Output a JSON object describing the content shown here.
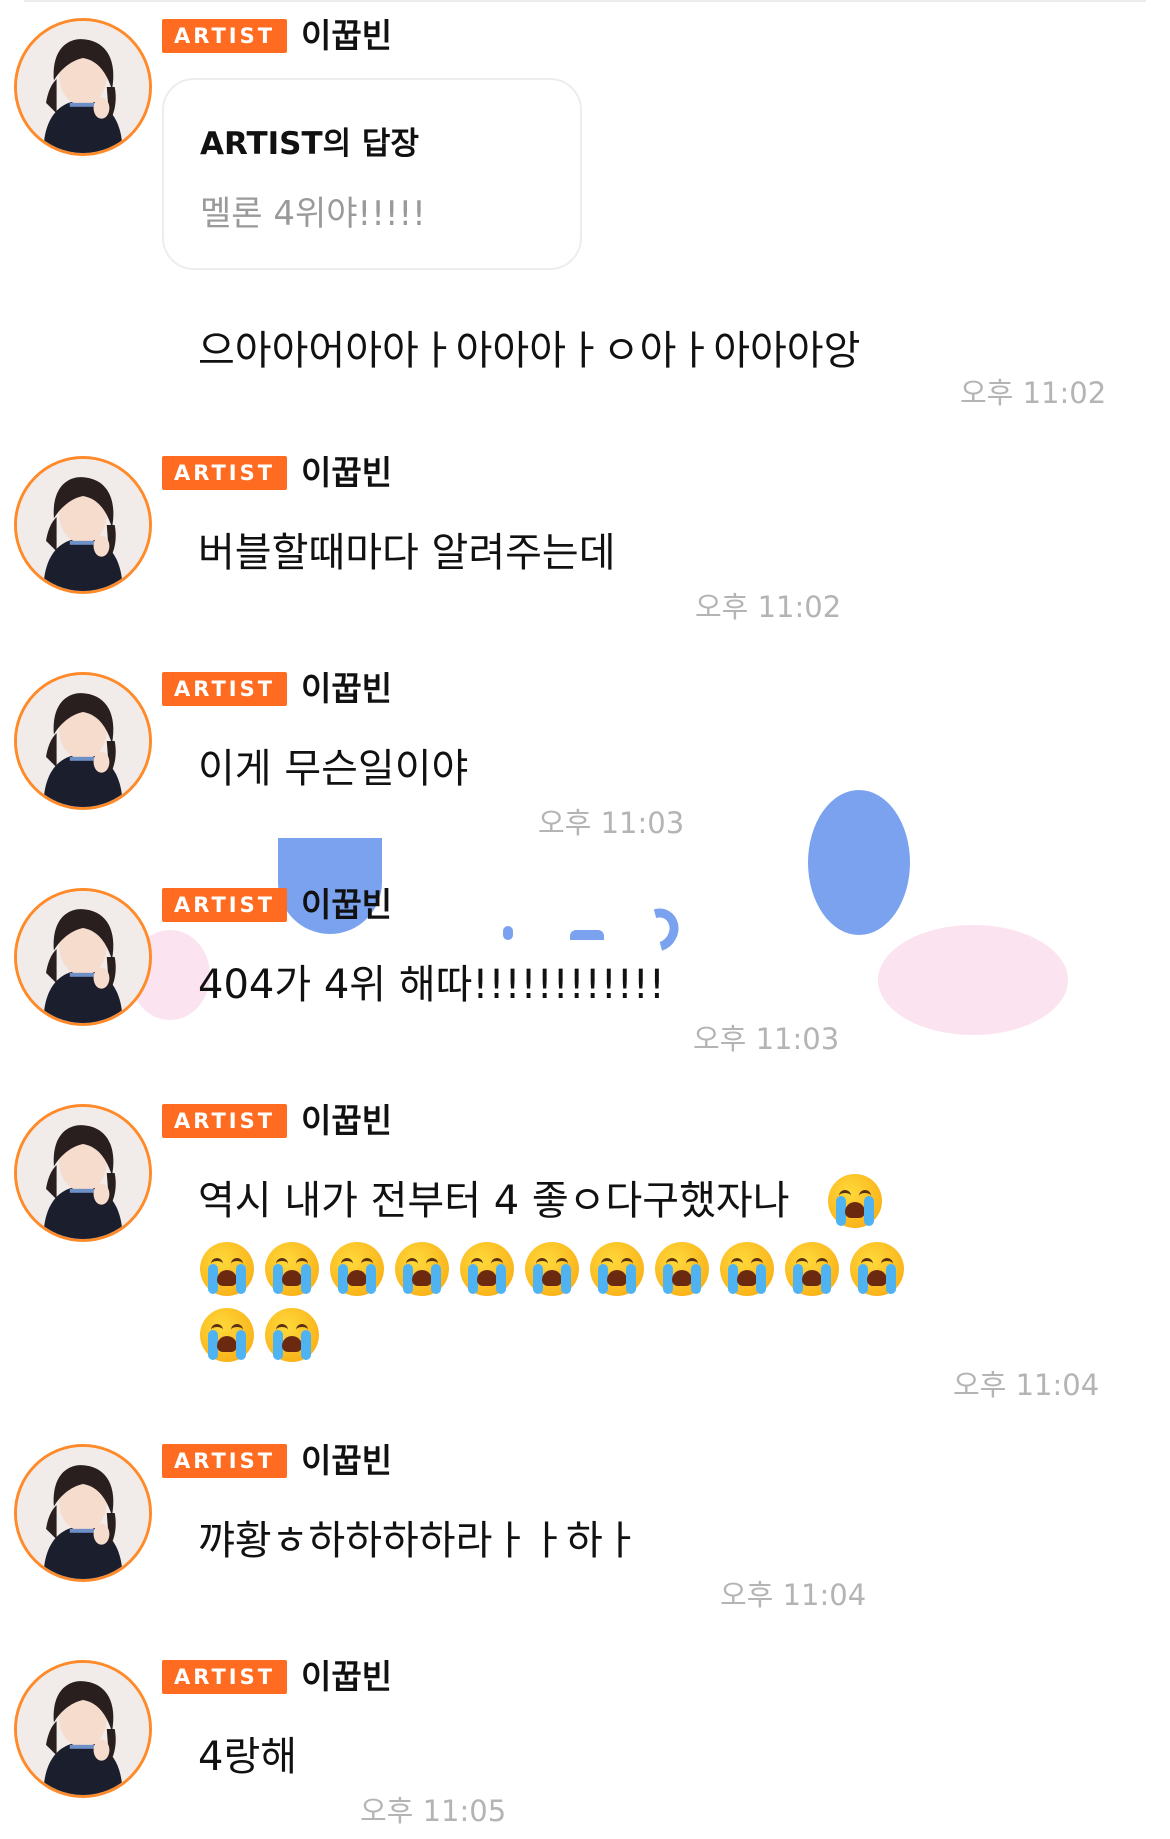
{
  "colors": {
    "badge": "#ff6b21",
    "avatar_ring": "#ff8a2a",
    "timestamp": "#b4b4b4",
    "reply_body": "#9a9a9a"
  },
  "icons": {
    "emoji": "loudly-crying-face-icon",
    "avatar": "artist-avatar"
  },
  "messages": [
    {
      "badge": "ARTIST",
      "name": "이꿉빈",
      "reply": {
        "title": "ARTIST의 답장",
        "body": "멜론 4위야!!!!!"
      },
      "text": "으아아어아아ㅏ아아아ㅏㅇ아ㅏ아아아앙",
      "time": "오후 11:02"
    },
    {
      "badge": "ARTIST",
      "name": "이꿉빈",
      "text": "버블할때마다 알려주는데",
      "time": "오후 11:02"
    },
    {
      "badge": "ARTIST",
      "name": "이꿉빈",
      "text": "이게 무슨일이야",
      "time": "오후 11:03"
    },
    {
      "badge": "ARTIST",
      "name": "이꿉빈",
      "text": "404가 4위 해따!!!!!!!!!!!!",
      "time": "오후 11:03"
    },
    {
      "badge": "ARTIST",
      "name": "이꿉빈",
      "text": "역시 내가 전부터 4 좋ㅇ다구했자나",
      "emoji_count_line1": 1,
      "emoji_count_line2": 11,
      "emoji_count_line3": 2,
      "time": "오후 11:04"
    },
    {
      "badge": "ARTIST",
      "name": "이꿉빈",
      "text": "꺄황ㅎ하하하하라ㅏㅏ하ㅏ",
      "time": "오후 11:04"
    },
    {
      "badge": "ARTIST",
      "name": "이꿉빈",
      "text": "4랑해",
      "time": "오후 11:05"
    }
  ]
}
